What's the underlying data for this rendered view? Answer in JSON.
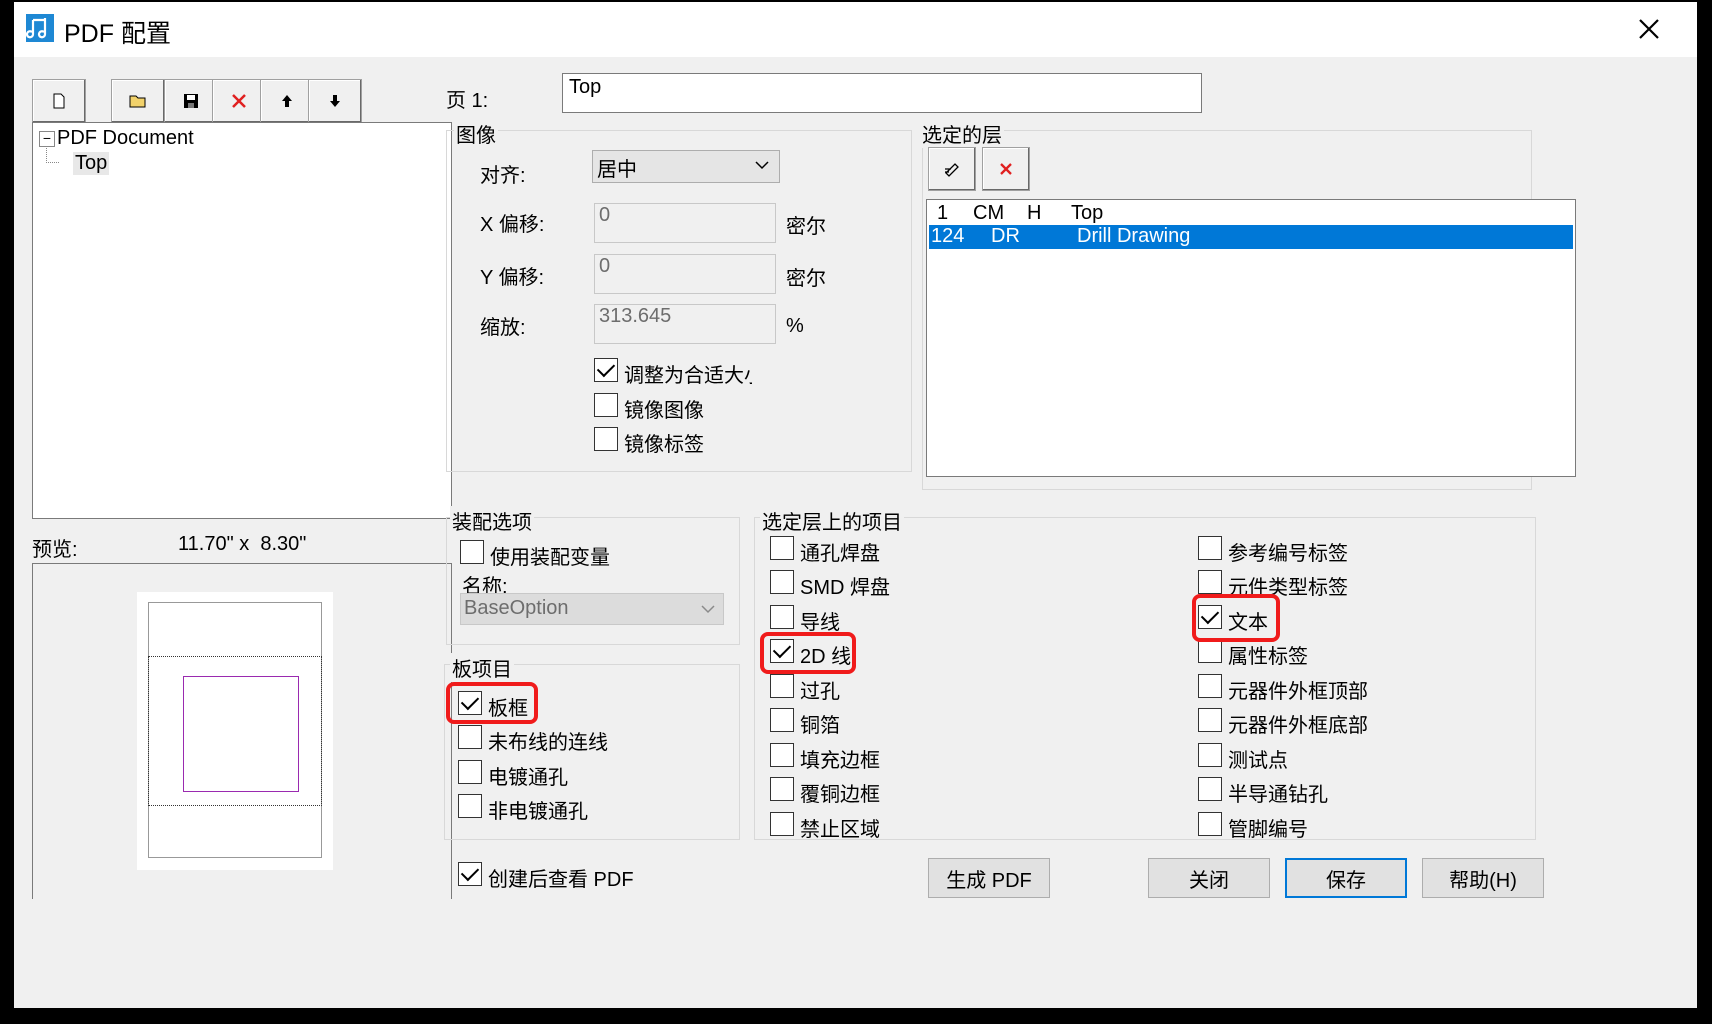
{
  "window": {
    "title": "PDF 配置",
    "close_icon": "✕"
  },
  "toolbar": {
    "new_icon": "new-document-icon",
    "open_icon": "open-folder-icon",
    "save_icon": "save-disk-icon",
    "delete_icon": "delete-x-icon",
    "up_icon": "move-up-icon",
    "down_icon": "move-down-icon"
  },
  "tree": {
    "root": "PDF Document",
    "child": "Top",
    "expander": "−"
  },
  "page": {
    "label": "页 1:",
    "value": "Top"
  },
  "image_group": {
    "title": "图像",
    "align_label": "对齐:",
    "align_value": "居中",
    "x_label": "X 偏移:",
    "x_value": "0",
    "x_unit": "密尔",
    "y_label": "Y 偏移:",
    "y_value": "0",
    "y_unit": "密尔",
    "scale_label": "缩放:",
    "scale_value": "313.645",
    "scale_unit": "%",
    "fit_label": "调整为合适大小",
    "mirror_image_label": "镜像图像",
    "mirror_label_label": "镜像标签"
  },
  "layers_group": {
    "title": "选定的层",
    "rows": [
      {
        "num": "1",
        "code": "CM",
        "flag": "H",
        "name": "Top"
      },
      {
        "num": "124",
        "code": "DR",
        "flag": "",
        "name": "Drill Drawing"
      }
    ]
  },
  "preview": {
    "label": "预览:",
    "size": "11.70\" x  8.30\""
  },
  "assembly_group": {
    "title": "装配选项",
    "use_variant": "使用装配变量",
    "name_label": "名称:",
    "name_value": "BaseOption"
  },
  "board_group": {
    "title": "板项目",
    "items": [
      "板框",
      "未布线的连线",
      "电镀通孔",
      "非电镀通孔"
    ]
  },
  "items_group": {
    "title": "选定层上的项目",
    "col1": [
      "通孔焊盘",
      "SMD 焊盘",
      "导线",
      "2D 线",
      "过孔",
      "铜箔",
      "填充边框",
      "覆铜边框",
      "禁止区域"
    ],
    "col2": [
      "参考编号标签",
      "元件类型标签",
      "文本",
      "属性标签",
      "元器件外框顶部",
      "元器件外框底部",
      "测试点",
      "半导通钻孔",
      "管脚编号"
    ]
  },
  "footer": {
    "view_pdf": "创建后查看 PDF",
    "generate": "生成 PDF",
    "close": "关闭",
    "save": "保存",
    "help": "帮助(H)"
  }
}
